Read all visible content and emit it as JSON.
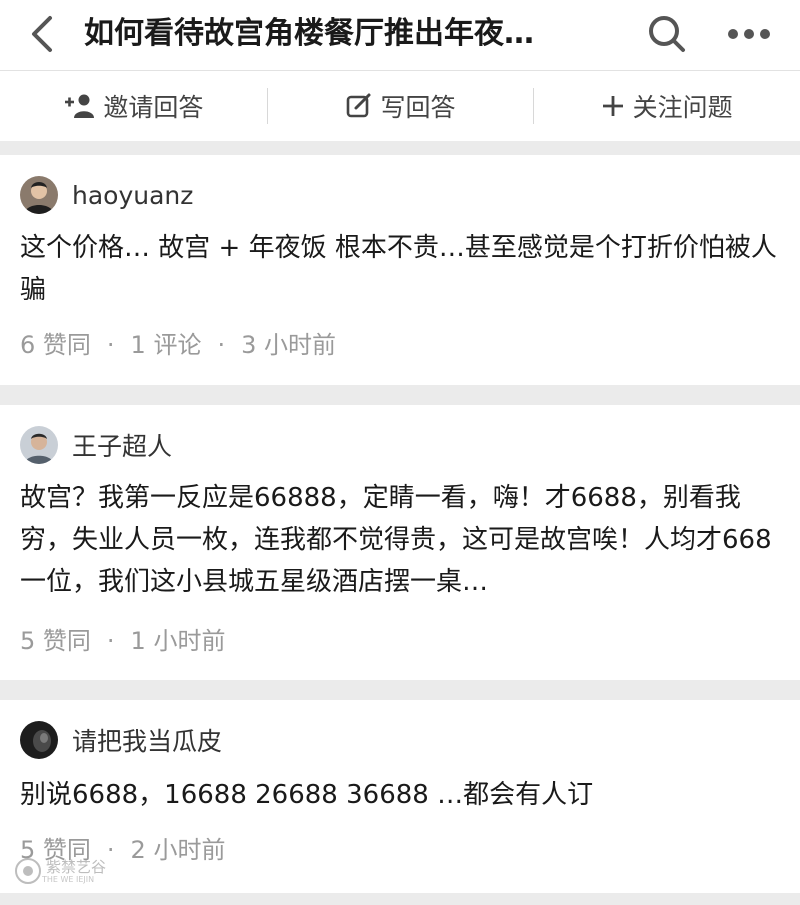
{
  "header": {
    "title": "如何看待故宫角楼餐厅推出年夜…",
    "back_icon": "chevron-left-icon",
    "search_icon": "search-icon",
    "more_icon": "more-horizontal-icon"
  },
  "actions": [
    {
      "label": "邀请回答",
      "icon": "add-user-icon"
    },
    {
      "label": "写回答",
      "icon": "edit-icon"
    },
    {
      "label": "关注问题",
      "icon": "plus-icon"
    }
  ],
  "answers": [
    {
      "author": "haoyuanz",
      "content": "这个价格… 故宫 + 年夜饭 根本不贵…甚至感觉是个打折价怕被人骗",
      "meta": [
        "6 赞同",
        "1 评论",
        "3 小时前"
      ]
    },
    {
      "author": "王子超人",
      "content": "故宫？我第一反应是66888，定睛一看，嗨！才6688，别看我穷，失业人员一枚，连我都不觉得贵，这可是故宫唉！人均才668一位，我们这小县城五星级酒店摆一桌…",
      "meta": [
        "5 赞同",
        "1 小时前"
      ]
    },
    {
      "author": "请把我当瓜皮",
      "content": "别说6688，16688 26688 36688 …都会有人订",
      "meta": [
        "5 赞同",
        "2 小时前"
      ]
    }
  ],
  "watermark": {
    "text": "紫禁艺谷",
    "sub": "THE WE IEJIN"
  },
  "colors": {
    "meta": "#9a9a9a",
    "divider": "#ebebeb",
    "text": "#1a1a1a"
  }
}
